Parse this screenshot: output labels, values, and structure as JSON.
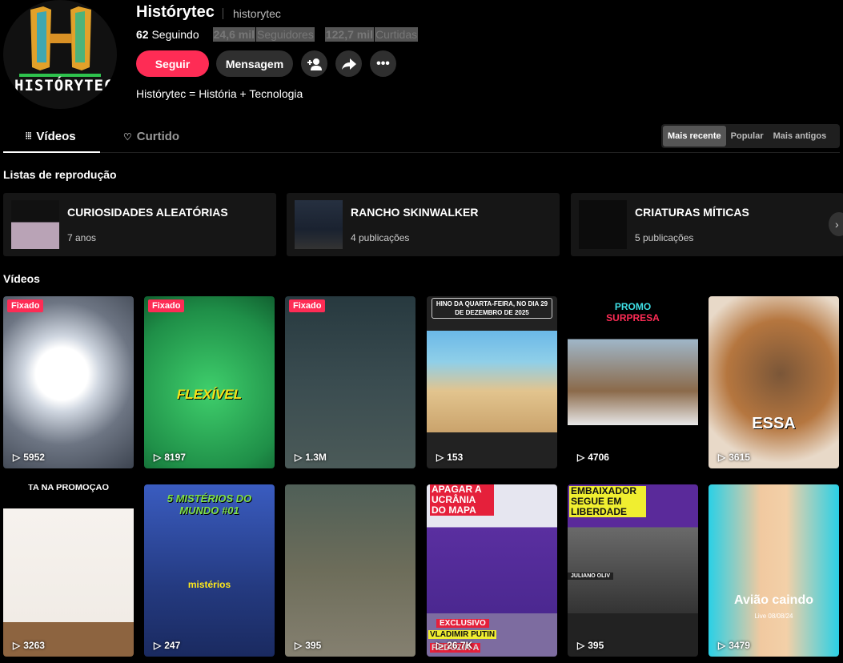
{
  "profile": {
    "name": "Histórytec",
    "handle": "historytec",
    "avatar_text": "HISTÓRYTEC",
    "following_count": "62",
    "following_label": "Seguindo",
    "followers_count": "24,6 mil",
    "followers_label": "Seguidores",
    "likes_count": "122,7 mil",
    "likes_label": "Curtidas",
    "bio": "Histórytec = História + Tecnologia"
  },
  "actions": {
    "follow": "Seguir",
    "message": "Mensagem",
    "add_friend_icon": "person-plus-icon",
    "share_icon": "share-arrow-icon",
    "more_icon": "ellipsis-icon"
  },
  "tabs": [
    {
      "label": "Vídeos",
      "icon": "grid-icon"
    },
    {
      "label": "Curtido",
      "icon": "heart-lock-icon"
    }
  ],
  "sort": [
    "Mais recente",
    "Popular",
    "Mais antigos"
  ],
  "playlists_title": "Listas de reprodução",
  "playlists": [
    {
      "title": "CURIOSIDADES ALEATÓRIAS",
      "sub": "7 anos"
    },
    {
      "title": "RANCHO SKINWALKER",
      "sub": "4 publicações"
    },
    {
      "title": "CRIATURAS MÍTICAS",
      "sub": "5 publicações"
    }
  ],
  "videos_title": "Vídeos",
  "pinned_label": "Fixado",
  "videos": [
    {
      "views": "5952",
      "caption": ""
    },
    {
      "views": "8197",
      "caption": "FLEXÍVEL"
    },
    {
      "views": "1.3M",
      "caption": ""
    },
    {
      "views": "153",
      "caption": "HINO DA QUARTA-FEIRA, NO DIA 29 DE DEZEMBRO DE 2025"
    },
    {
      "views": "4706",
      "caption": "PROMO",
      "caption2": "SURPRESA"
    },
    {
      "views": "3615",
      "caption": "ESSA"
    },
    {
      "views": "3263",
      "caption": "TA NA PROMOÇÃO"
    },
    {
      "views": "247",
      "caption": "5 MISTÉRIOS DO MUNDO #01",
      "caption2": "mistérios"
    },
    {
      "views": "395",
      "caption": ""
    },
    {
      "views": "26,7K",
      "caption": "APAGAR A UCRÂNIA DO MAPA",
      "caption2": "EXCLUSIVO",
      "caption3": "VLADIMIR PUTIN",
      "caption4": "REDUZIR A"
    },
    {
      "views": "395",
      "caption": "EMBAIXADOR SEGUE EM LIBERDADE",
      "caption2": "JULIANO OLIV"
    },
    {
      "views": "3479",
      "caption": "Avião caindo",
      "caption2": "Live 08/08/24"
    }
  ],
  "colors": {
    "accent": "#fe2c55",
    "background": "#000000",
    "card": "#161616"
  }
}
